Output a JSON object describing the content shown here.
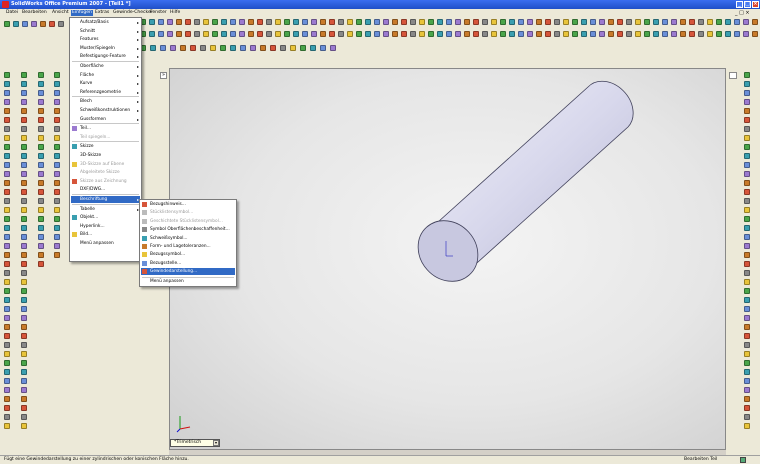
{
  "window": {
    "title": "SolidWorks Office Premium 2007 - [Teil1 *]"
  },
  "menubar": {
    "items": [
      "Datei",
      "Bearbeiten",
      "Ansicht",
      "Einfügen",
      "Extras",
      "Gewinde-Checker",
      "Fenster",
      "Hilfe"
    ]
  },
  "insert_menu": {
    "items": [
      {
        "label": "Aufsatz/Basis",
        "sub": true
      },
      {
        "label": "Schnitt",
        "sub": true
      },
      {
        "label": "Features",
        "sub": true
      },
      {
        "label": "Muster/Spiegeln",
        "sub": true
      },
      {
        "label": "Befestigungs-Feature",
        "sub": true
      },
      {
        "label": "Oberfläche",
        "sub": true
      },
      {
        "label": "Fläche",
        "sub": true
      },
      {
        "label": "Kurve",
        "sub": true
      },
      {
        "label": "Referenzgeometrie",
        "sub": true
      },
      {
        "label": "Blech",
        "sub": true
      },
      {
        "label": "Schweißkonstruktionen",
        "sub": true
      },
      {
        "label": "Gussformen",
        "sub": true
      },
      {
        "label": "Teil...",
        "sub": false
      },
      {
        "label": "Teil spiegeln...",
        "sub": false,
        "disabled": true
      },
      {
        "label": "Skizze",
        "sub": false
      },
      {
        "label": "3D-Skizze",
        "sub": false
      },
      {
        "label": "3D-Skizze auf Ebene",
        "sub": false,
        "disabled": true
      },
      {
        "label": "Abgeleitete Skizze",
        "sub": false,
        "disabled": true
      },
      {
        "label": "Skizze aus Zeichnung",
        "sub": false,
        "disabled": true
      },
      {
        "label": "DXF/DWG...",
        "sub": false
      },
      {
        "label": "Beschriftung",
        "sub": true,
        "highlighted": true
      },
      {
        "label": "Tabelle",
        "sub": true
      },
      {
        "label": "Objekt...",
        "sub": false
      },
      {
        "label": "Hyperlink...",
        "sub": false
      },
      {
        "label": "Bild...",
        "sub": false
      },
      {
        "label": "Menü anpassen",
        "sub": false
      }
    ]
  },
  "annotation_menu": {
    "items": [
      {
        "label": "Bezugshinweis..."
      },
      {
        "label": "Stücklistensymbol...",
        "disabled": true
      },
      {
        "label": "Geschichtete Stücklistensymbol...",
        "disabled": true
      },
      {
        "label": "Symbol Oberflächenbeschaffenheit..."
      },
      {
        "label": "Schweißsymbol..."
      },
      {
        "label": "Form- und Lagetoleranzen..."
      },
      {
        "label": "Bezugssymbol..."
      },
      {
        "label": "Bezugsstelle..."
      },
      {
        "label": "Gewindedarstellung...",
        "highlighted": true
      },
      {
        "label": "Menü anpassen"
      }
    ]
  },
  "viewport": {
    "view_label": "*Trimetrisch"
  },
  "statusbar": {
    "hint": "Fügt eine Gewindedarstellung zu einer zylindrischen oder konischen Fläche hinzu.",
    "mode": "Bearbeiten Teil"
  },
  "colors": {
    "highlight": "#316ac5",
    "titlebar": "#1f4fc8",
    "cylinder": "#d6d6ec"
  }
}
